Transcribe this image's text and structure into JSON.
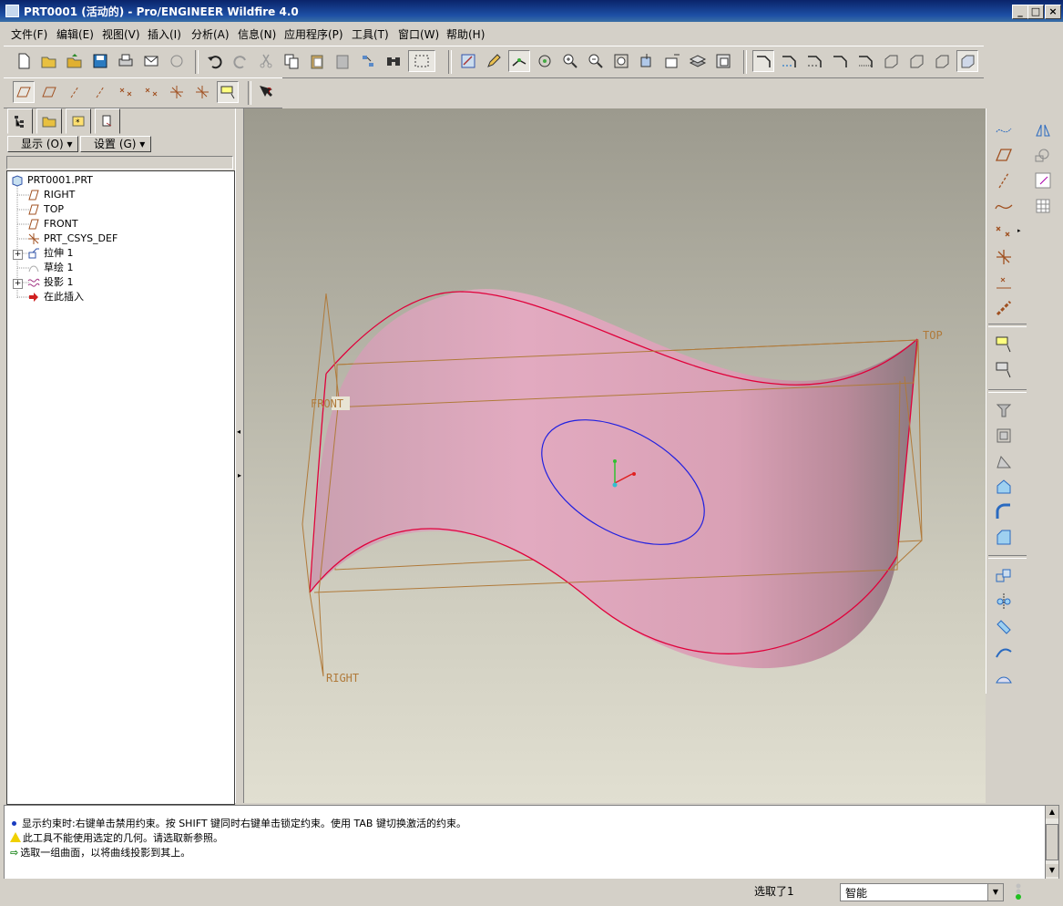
{
  "window": {
    "title": "PRT0001 (活动的) - Pro/ENGINEER Wildfire 4.0",
    "min": "_",
    "max": "□",
    "close": "×"
  },
  "menu": [
    "文件(F)",
    "编辑(E)",
    "视图(V)",
    "插入(I)",
    "分析(A)",
    "信息(N)",
    "应用程序(P)",
    "工具(T)",
    "窗口(W)",
    "帮助(H)"
  ],
  "navigator": {
    "show_label": "显示 (O)",
    "settings_label": "设置 (G)"
  },
  "tree": [
    {
      "label": "PRT0001.PRT",
      "icon": "part-icon"
    },
    {
      "label": "RIGHT",
      "icon": "datum-plane-icon"
    },
    {
      "label": "TOP",
      "icon": "datum-plane-icon"
    },
    {
      "label": "FRONT",
      "icon": "datum-plane-icon"
    },
    {
      "label": "PRT_CSYS_DEF",
      "icon": "csys-icon"
    },
    {
      "label": "拉伸 1",
      "icon": "extrude-icon"
    },
    {
      "label": "草绘 1",
      "icon": "sketch-icon"
    },
    {
      "label": "投影 1",
      "icon": "project-icon"
    },
    {
      "label": "在此插入",
      "icon": "insert-here-icon"
    }
  ],
  "viewport": {
    "labels": {
      "top": "TOP",
      "front": "FRONT",
      "right": "RIGHT"
    },
    "colors": {
      "surface": "#e0a0b8",
      "edge": "#e0003a",
      "datum": "#b07a3a",
      "sketch": "#2020e0"
    }
  },
  "messages": [
    {
      "icon": "info-bullet-icon",
      "text": "显示约束时:右键单击禁用约束。按 SHIFT 键同时右键单击锁定约束。使用 TAB 键切换激活的约束。"
    },
    {
      "icon": "warning-icon",
      "text": "此工具不能使用选定的几何。请选取新参照。"
    },
    {
      "icon": "prompt-arrow-icon",
      "text": "选取一组曲面，以将曲线投影到其上。"
    }
  ],
  "status": {
    "selected": "选取了1",
    "filter_value": "智能"
  }
}
